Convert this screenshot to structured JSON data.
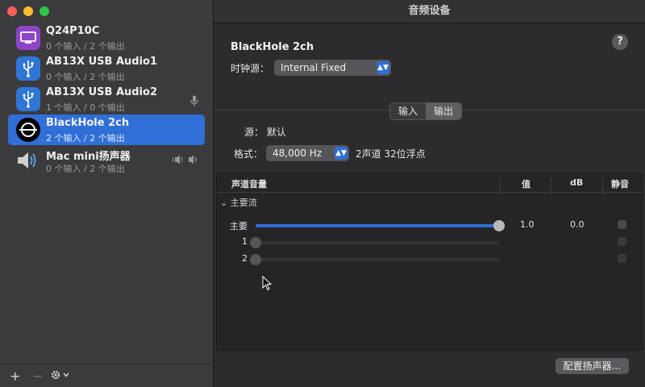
{
  "window": {
    "title": "音频设备"
  },
  "sidebar": {
    "devices": [
      {
        "name": "Q24P10C",
        "sub": "0 个输入 / 2 个输出",
        "icon": "display-icon",
        "color": "#8e44c8",
        "selected": false
      },
      {
        "name": "AB13X USB Audio1",
        "sub": "0 个输入 / 2 个输出",
        "icon": "usb-icon",
        "color": "#2f76d6",
        "selected": false
      },
      {
        "name": "AB13X USB Audio2",
        "sub": "1 个输入 / 0 个输出",
        "icon": "usb-icon",
        "color": "#2f76d6",
        "selected": false
      },
      {
        "name": "BlackHole 2ch",
        "sub": "2 个输入 / 2 个输出",
        "icon": "blackhole-icon",
        "color": "#000000",
        "selected": true
      },
      {
        "name": "Mac mini扬声器",
        "sub": "0 个输入 / 2 个输出",
        "icon": "speaker-icon",
        "color": "#3b3b3d",
        "selected": false
      }
    ],
    "add_label": "+",
    "remove_label": "−"
  },
  "detail": {
    "device_title": "BlackHole 2ch",
    "help_label": "?",
    "clock_label": "时钟源：",
    "clock_value": "Internal Fixed",
    "tabs": [
      {
        "label": "输入",
        "active": false
      },
      {
        "label": "输出",
        "active": true
      }
    ],
    "source_label": "源：",
    "source_value": "默认",
    "format_label": "格式：",
    "format_value": "48,000 Hz",
    "format_desc": "2声道 32位浮点",
    "table": {
      "headers": {
        "channel": "声道音量",
        "value": "值",
        "db": "dB",
        "mute": "静音"
      },
      "group_label": "主要流",
      "rows": [
        {
          "label": "主要",
          "level": 1.0,
          "value": "1.0",
          "db": "0.0",
          "active": true
        },
        {
          "label": "1",
          "level": 0.0,
          "value": "",
          "db": "",
          "active": false
        },
        {
          "label": "2",
          "level": 0.0,
          "value": "",
          "db": "",
          "active": false
        }
      ]
    },
    "config_button": "配置扬声器..."
  }
}
